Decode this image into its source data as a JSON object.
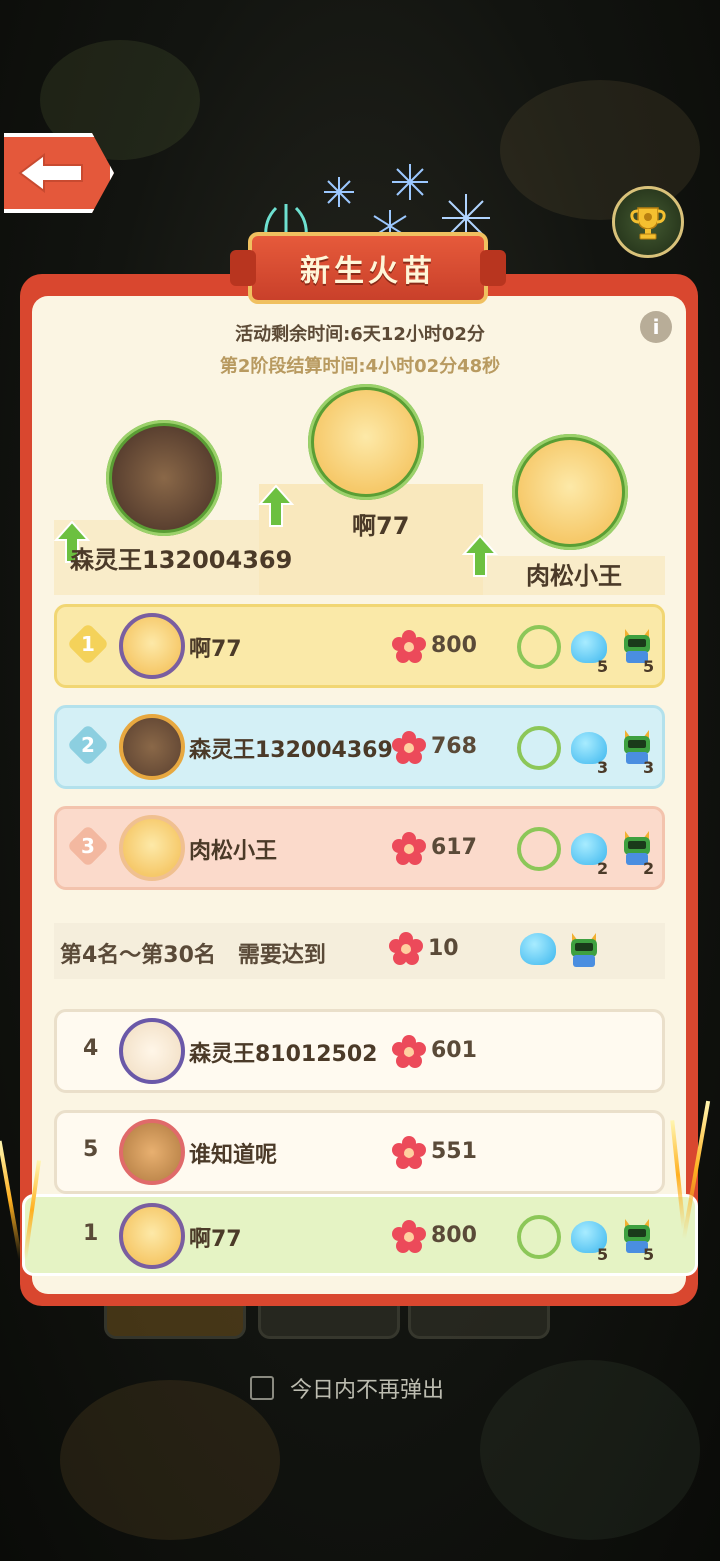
{
  "title": "新生火苗",
  "remaining_time": "活动剩余时间:6天12小时02分",
  "stage_time": "第2阶段结算时间:4小时02分48秒",
  "podium": [
    {
      "place": 2,
      "name": "森灵王132004369"
    },
    {
      "place": 1,
      "name": "啊77"
    },
    {
      "place": 3,
      "name": "肉松小王"
    }
  ],
  "top_rows": [
    {
      "rank": "1",
      "name": "啊77",
      "score": "800",
      "slime_count": "5",
      "robot_count": "5"
    },
    {
      "rank": "2",
      "name": "森灵王132004369",
      "score": "768",
      "slime_count": "3",
      "robot_count": "3"
    },
    {
      "rank": "3",
      "name": "肉松小王",
      "score": "617",
      "slime_count": "2",
      "robot_count": "2"
    }
  ],
  "requirement": {
    "label": "第4名～第30名　需要达到",
    "score": "10"
  },
  "other_rows": [
    {
      "rank": "4",
      "name": "森灵王81012502",
      "score": "601"
    },
    {
      "rank": "5",
      "name": "谁知道呢",
      "score": "551"
    }
  ],
  "my_row": {
    "rank": "1",
    "name": "啊77",
    "score": "800",
    "slime_count": "5",
    "robot_count": "5"
  },
  "dont_show_today": "今日内不再弹出",
  "colors": {
    "panel_red": "#d9472f",
    "gold_row": "#fae9a8",
    "blue_row": "#d4f0f6",
    "pink_row": "#fbdacb",
    "me_row": "#e5f3c4"
  },
  "icons": [
    "back-arrow-icon",
    "trophy-icon",
    "info-icon",
    "flower-icon",
    "wreath-icon",
    "slime-icon",
    "robot-icon",
    "up-arrow-icon"
  ]
}
